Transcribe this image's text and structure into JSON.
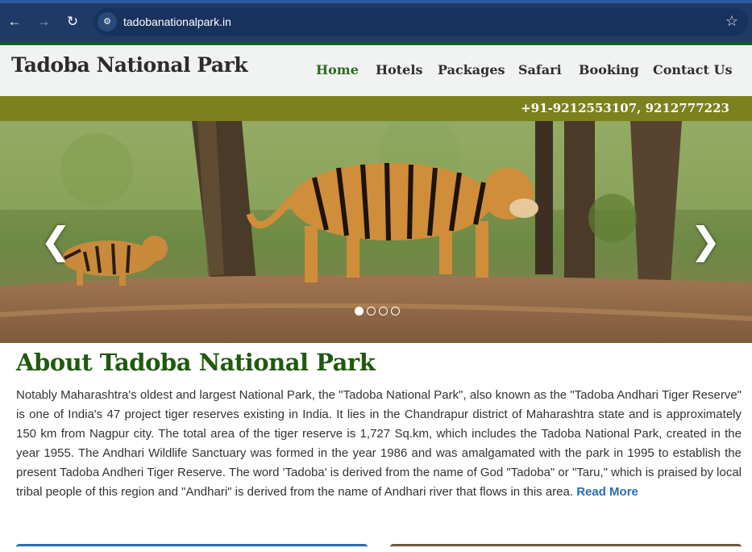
{
  "browser": {
    "url": "tadobanationalpark.in",
    "icons": [
      "back-arrow-icon",
      "forward-arrow-icon",
      "reload-icon",
      "site-info-icon",
      "bookmark-star-icon"
    ]
  },
  "header": {
    "logo": "Tadoba National Park",
    "menu": [
      {
        "label": "Home",
        "active": true
      },
      {
        "label": "Hotels",
        "active": false
      },
      {
        "label": "Packages",
        "active": false
      },
      {
        "label": "Safari",
        "active": false
      },
      {
        "label": "Booking",
        "active": false
      },
      {
        "label": "Contact Us",
        "active": false
      }
    ],
    "active_color": "#2d6a1f"
  },
  "contact_bar": {
    "phone": "+91-9212553107, 9212777223",
    "color": "#7b821d"
  },
  "slider": {
    "prev": "❮",
    "next": "❯",
    "slide_count": 4,
    "active_slide": 1
  },
  "about": {
    "title": "About Tadoba National Park",
    "text": "Notably Maharashtra's oldest and largest National Park, the \"Tadoba National Park\", also known as the \"Tadoba Andhari Tiger Reserve\" is one of India's 47 project tiger reserves existing in India. It lies in the Chandrapur district of Maharashtra state and is approximately 150 km from Nagpur city. The total area of the tiger reserve is 1,727 Sq.km, which includes the Tadoba National Park, created in the year 1955. The Andhari Wildlife Sanctuary was formed in the year 1986 and was amalgamated with the park in 1995 to establish the present Tadoba Andheri Tiger Reserve. The word 'Tadoba' is derived from the name of God \"Tadoba\" or \"Taru,\" which is praised by local tribal people of this region and \"Andhari\" is derived from the name of Andhari river that flows in this area.",
    "read_more": "Read More",
    "title_color": "#1f5a0f"
  }
}
